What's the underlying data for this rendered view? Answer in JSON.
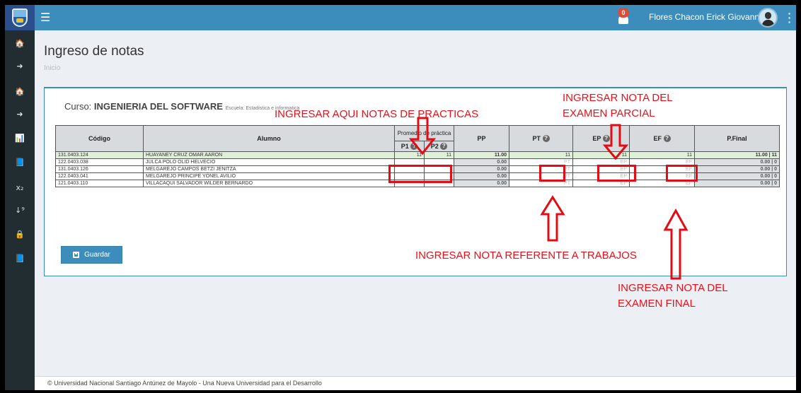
{
  "topbar": {
    "notification_count": "0",
    "user_name": "Flores Chacon Erick Giovanny",
    "accent_color": "#3c8dbc"
  },
  "sidebar": {
    "items": [
      {
        "icon": "home-icon",
        "glyph": "🏠"
      },
      {
        "icon": "sign-in-icon",
        "glyph": "➜"
      },
      {
        "icon": "home-icon",
        "glyph": "🏠"
      },
      {
        "icon": "sign-in-icon",
        "glyph": "➜"
      },
      {
        "icon": "bar-chart-icon",
        "glyph": "📊"
      },
      {
        "icon": "book-icon",
        "glyph": "📘"
      },
      {
        "icon": "subscript-icon",
        "glyph": "x₂"
      },
      {
        "icon": "sort-numeric-icon",
        "glyph": "↓⁹"
      },
      {
        "icon": "lock-icon",
        "glyph": "🔒"
      },
      {
        "icon": "book-icon",
        "glyph": "📘"
      }
    ]
  },
  "page": {
    "title": "Ingreso de notas",
    "breadcrumb": "Inicio"
  },
  "course": {
    "prefix": "Curso:",
    "name": "INGENIERIA DEL SOFTWARE",
    "school": "Escuela: Estadistica e informatica"
  },
  "table": {
    "headers": {
      "codigo": "Código",
      "alumno": "Alumno",
      "promedio": "Promedio de práctica",
      "p1": "P1",
      "p2": "P2",
      "pp": "PP",
      "pt": "PT",
      "ep": "EP",
      "ef": "EF",
      "pfinal": "P.Final"
    },
    "rows": [
      {
        "codigo": "131.0403.124",
        "alumno": "HUAYANEY CRUZ OMAR AARON",
        "p1": "11",
        "p2": "11",
        "pp": "11.00",
        "pt": "11",
        "ep": "11",
        "ef": "11",
        "pfinal": "11.00 | 11"
      },
      {
        "codigo": "122.0403.038",
        "alumno": "JULCA POLO OLID HELVECIO",
        "p1": "",
        "p2": "",
        "pp": "0.00",
        "pt": "PT",
        "ep": "EP",
        "ef": "EF",
        "pfinal": "0.00 | 0"
      },
      {
        "codigo": "131.0403.126",
        "alumno": "MELGAREJO CAMPOS BETZI JENITZA",
        "p1": "",
        "p2": "",
        "pp": "0.00",
        "pt": "PT",
        "ep": "EP",
        "ef": "EF",
        "pfinal": "0.00 | 0"
      },
      {
        "codigo": "122.0403.041",
        "alumno": "MELGAREJO PRINCIPE YONEL AVILIO",
        "p1": "",
        "p2": "",
        "pp": "0.00",
        "pt": "PT",
        "ep": "EP",
        "ef": "EF",
        "pfinal": "0.00 | 0"
      },
      {
        "codigo": "121.0403.110",
        "alumno": "VILLACAQUI SALVADOR WILDER BERNARDO",
        "p1": "",
        "p2": "",
        "pp": "0.00",
        "pt": "PT",
        "ep": "EP",
        "ef": "EF",
        "pfinal": "0.00 | 0"
      }
    ]
  },
  "actions": {
    "save_label": "Guardar"
  },
  "footer": {
    "text": "© Universidad Nacional Santiago Antúnez de Mayolo - Una Nueva Universidad para el Desarrollo"
  },
  "annotations": {
    "practicas": "INGRESAR AQUI NOTAS DE PRACTICAS",
    "parcial_1": "INGRESAR NOTA DEL",
    "parcial_2": "EXAMEN PARCIAL",
    "trabajos": "INGRESAR NOTA REFERENTE A TRABAJOS",
    "final_1": "INGRESAR NOTA DEL",
    "final_2": "EXAMEN FINAL",
    "color": "#e8101a"
  }
}
